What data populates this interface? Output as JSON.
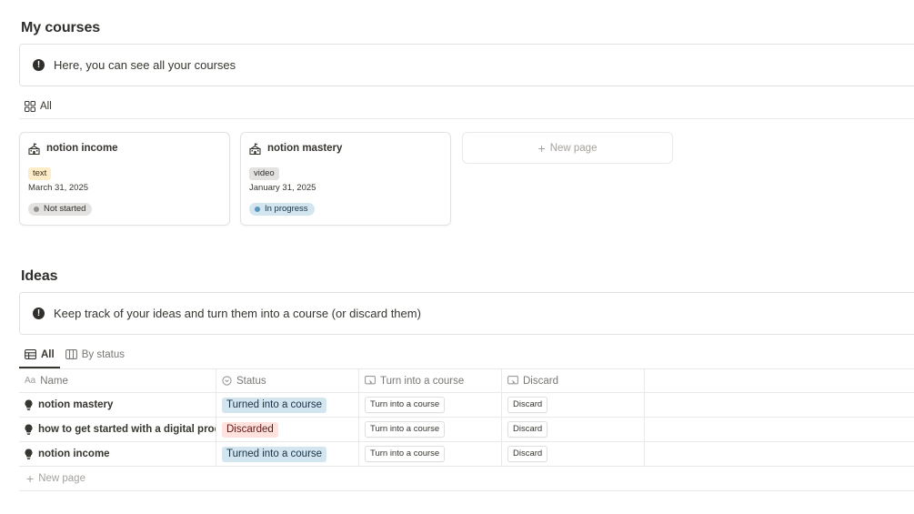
{
  "courses": {
    "title": "My courses",
    "callout": "Here, you can see all your courses",
    "view_tab": "All",
    "cards": [
      {
        "title": "notion income",
        "tag": "text",
        "date": "March 31, 2025",
        "status": "Not started"
      },
      {
        "title": "notion mastery",
        "tag": "video",
        "date": "January 31, 2025",
        "status": "In progress"
      }
    ],
    "new_page": "New page"
  },
  "ideas": {
    "title": "Ideas",
    "callout": "Keep track of your ideas and turn them into a course (or discard them)",
    "tabs": [
      {
        "label": "All"
      },
      {
        "label": "By status"
      }
    ],
    "columns": {
      "name_prefix": "Aa",
      "name": "Name",
      "status": "Status",
      "turn": "Turn into a course",
      "discard": "Discard"
    },
    "rows": [
      {
        "name": "notion mastery",
        "status": "Turned into a course",
        "turn_btn": "Turn into a course",
        "discard_btn": "Discard"
      },
      {
        "name": "how to get started with a digital produ",
        "status": "Discarded",
        "turn_btn": "Turn into a course",
        "discard_btn": "Discard"
      },
      {
        "name": "notion income",
        "status": "Turned into a course",
        "turn_btn": "Turn into a course",
        "discard_btn": "Discard"
      }
    ],
    "new_page": "New page"
  },
  "colors": {
    "tag_text_bg": "#fdecc8",
    "tag_video_bg": "#e3e2e0",
    "not_started_bg": "#e3e2e0",
    "not_started_dot": "#91918e",
    "in_progress_bg": "#d3e5ef",
    "in_progress_dot": "#5b97bd",
    "turned_bg": "#d3e5ef",
    "turned_text": "#183347",
    "discarded_bg": "#ffe2dd",
    "discarded_text": "#5d1715"
  }
}
